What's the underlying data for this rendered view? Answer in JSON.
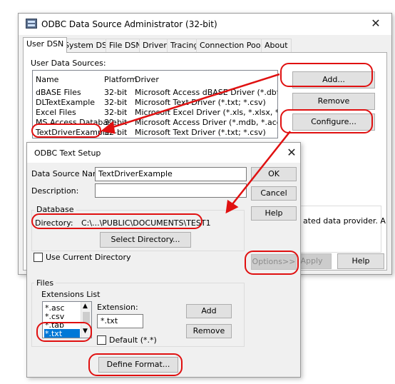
{
  "main_window": {
    "title": "ODBC Data Source Administrator (32-bit)",
    "tabs": [
      "User DSN",
      "System DSN",
      "File DSN",
      "Drivers",
      "Tracing",
      "Connection Pooling",
      "About"
    ],
    "list_label": "User Data Sources:",
    "columns": [
      "Name",
      "Platform",
      "Driver"
    ],
    "rows": [
      {
        "name": "dBASE Files",
        "platform": "32-bit",
        "driver": "Microsoft Access dBASE Driver (*.dbf, *.ndx, *.m"
      },
      {
        "name": "DLTextExample",
        "platform": "32-bit",
        "driver": "Microsoft Text Driver (*.txt; *.csv)"
      },
      {
        "name": "Excel Files",
        "platform": "32-bit",
        "driver": "Microsoft Excel Driver (*.xls, *.xlsx, *.xlsm, *.xlsb)"
      },
      {
        "name": "MS Access Database",
        "platform": "32-bit",
        "driver": "Microsoft Access Driver (*.mdb, *.accdb)"
      },
      {
        "name": "TextDriverExample",
        "platform": "32-bit",
        "driver": "Microsoft Text Driver (*.txt; *.csv)"
      }
    ],
    "add_label": "Add...",
    "remove_label": "Remove",
    "configure_label": "Configure...",
    "info_text": "ated data provider.  A",
    "apply_label": "Apply",
    "help_label": "Help"
  },
  "text_setup": {
    "title": "ODBC Text Setup",
    "dsn_label": "Data Source Name:",
    "dsn_value": "TextDriverExample",
    "description_label": "Description:",
    "description_value": "",
    "ok_label": "OK",
    "cancel_label": "Cancel",
    "help_label": "Help",
    "options_label": "Options>>",
    "database_group": "Database",
    "directory_label": "Directory:",
    "directory_value": "C:\\...\\PUBLIC\\DOCUMENTS\\TEST1",
    "select_dir_label": "Select Directory...",
    "use_current_label": "Use Current Directory",
    "files_group": "Files",
    "ext_list_label": "Extensions List",
    "ext_items": [
      "*.asc",
      "*.csv",
      "*.tab"
    ],
    "ext_selected": "*.txt",
    "extension_label": "Extension:",
    "extension_value": "*.txt",
    "add_label": "Add",
    "remove_label": "Remove",
    "default_label": "Default (*.*)",
    "define_format_label": "Define Format..."
  },
  "colors": {
    "annotation_red": "#e01010",
    "selection_blue": "#0078d7"
  }
}
